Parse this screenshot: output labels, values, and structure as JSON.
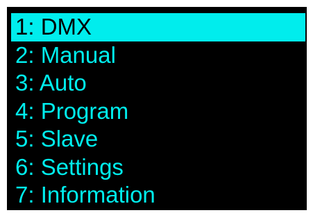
{
  "menu": {
    "items": [
      {
        "label": "1: DMX",
        "selected": true
      },
      {
        "label": "2: Manual",
        "selected": false
      },
      {
        "label": "3: Auto",
        "selected": false
      },
      {
        "label": "4: Program",
        "selected": false
      },
      {
        "label": "5: Slave",
        "selected": false
      },
      {
        "label": "6: Settings",
        "selected": false
      },
      {
        "label": "7: Information",
        "selected": false
      }
    ]
  },
  "colors": {
    "background": "#000000",
    "text": "#00eded",
    "highlight": "#00eded",
    "highlight_text": "#000000"
  }
}
